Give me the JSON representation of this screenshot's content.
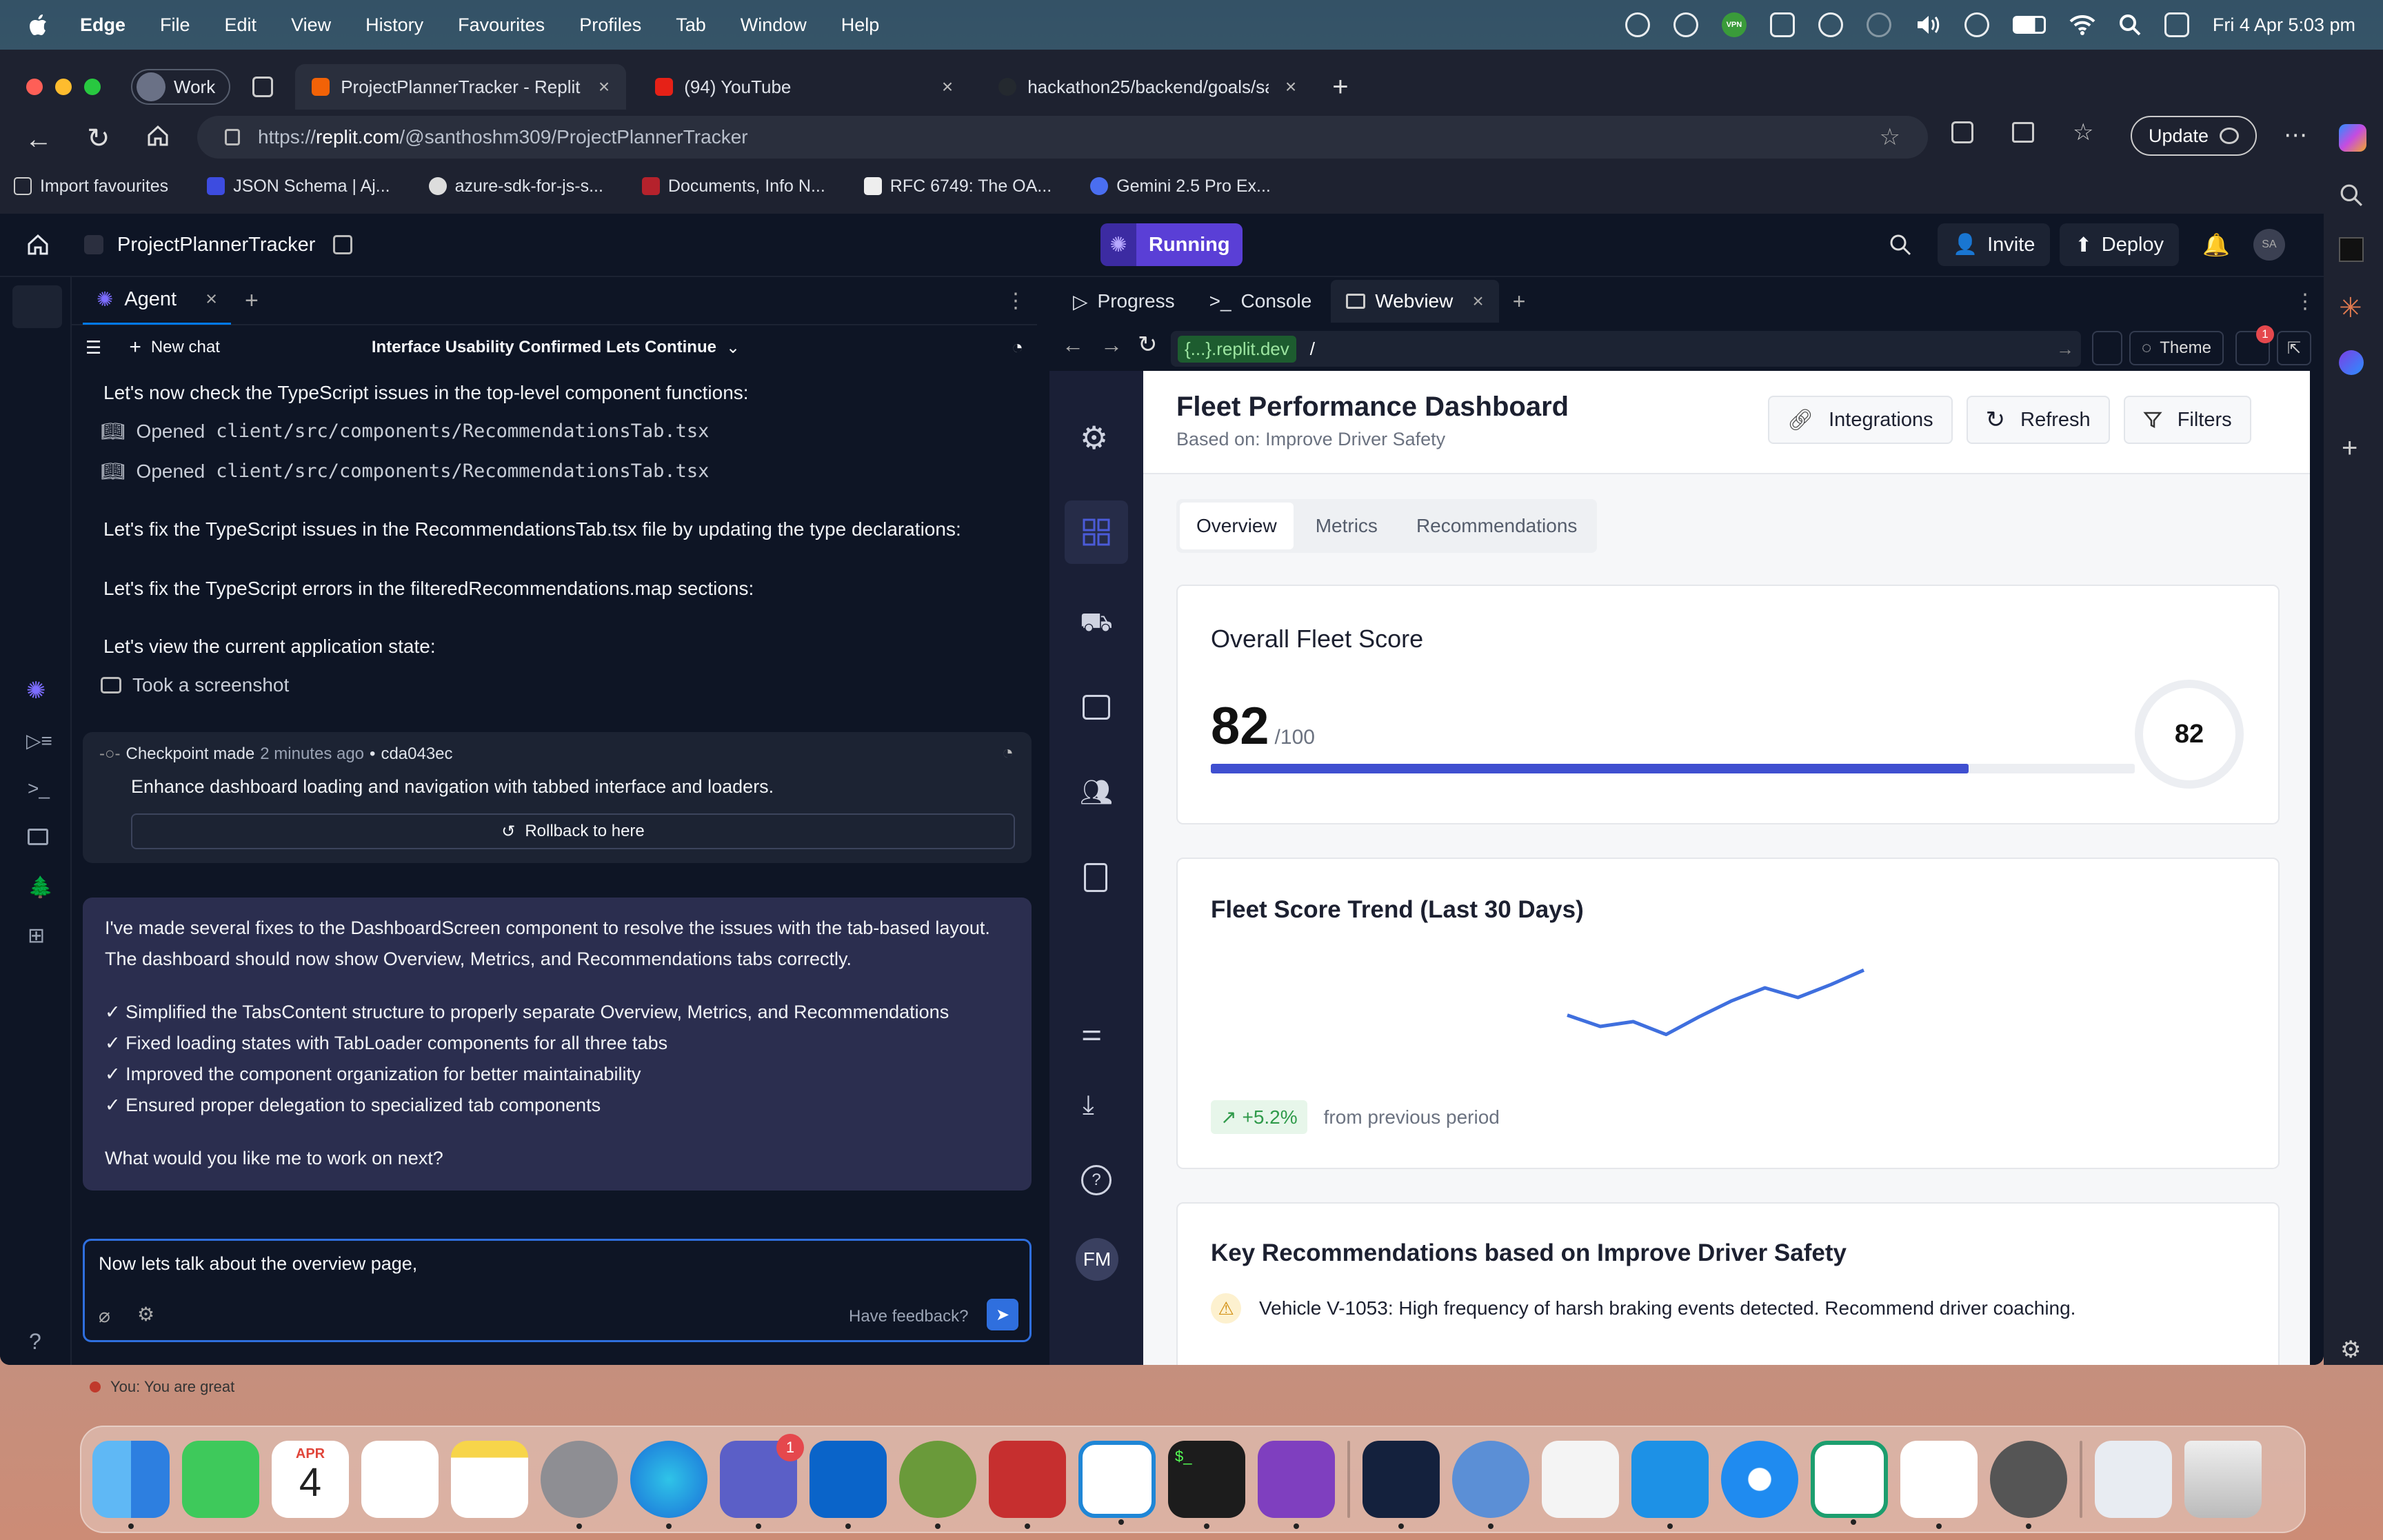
{
  "menubar": {
    "app": "Edge",
    "items": [
      "File",
      "Edit",
      "View",
      "History",
      "Favourites",
      "Profiles",
      "Tab",
      "Window",
      "Help"
    ],
    "clock": "Fri 4 Apr  5:03 pm"
  },
  "browser": {
    "profile": "Work",
    "tabs": [
      {
        "title": "ProjectPlannerTracker - Replit"
      },
      {
        "title": "(94) YouTube"
      },
      {
        "title": "hackathon25/backend/goals/sa"
      }
    ],
    "url_prefix": "https://",
    "url_domain": "replit.com",
    "url_path": "/@santhoshm309/ProjectPlannerTracker",
    "update": "Update",
    "bookmarks": [
      "Import favourites",
      "JSON Schema | Aj...",
      "azure-sdk-for-js-s...",
      "Documents, Info N...",
      "RFC 6749: The OA...",
      "Gemini 2.5 Pro Ex..."
    ]
  },
  "replit": {
    "project": "ProjectPlannerTracker",
    "running": "Running",
    "invite": "Invite",
    "deploy": "Deploy",
    "avatar": "SA",
    "agent": {
      "tab": "Agent",
      "new_chat": "New chat",
      "chat_title": "Interface Usability Confirmed Lets Continue",
      "lines": [
        "Let's now check the TypeScript issues in the top-level component functions:",
        "Let's fix the TypeScript issues in the RecommendationsTab.tsx file by updating the type declarations:",
        "Let's fix the TypeScript errors in the filteredRecommendations.map sections:",
        "Let's view the current application state:"
      ],
      "opened_label": "Opened",
      "opened_file": "client/src/components/RecommendationsTab.tsx",
      "screenshot": "Took a screenshot",
      "checkpoint": {
        "label": "Checkpoint made",
        "time": "2 minutes ago",
        "dot": "•",
        "commit": "cda043ec",
        "desc": "Enhance dashboard loading and navigation with tabbed interface and loaders.",
        "rollback": "Rollback to here"
      },
      "reply": {
        "intro": "I've made several fixes to the DashboardScreen component to resolve the issues with the tab-based layout. The dashboard should now show Overview, Metrics, and Recommendations tabs correctly.",
        "bullets": [
          "✓ Simplified the TabsContent structure to properly separate Overview, Metrics, and Recommendations",
          "✓ Fixed loading states with TabLoader components for all three tabs",
          "✓ Improved the component organization for better maintainability",
          "✓ Ensured proper delegation to specialized tab components"
        ],
        "question": "What would you like me to work on next?"
      },
      "input_value": "Now lets talk about the overview page,",
      "feedback": "Have feedback?"
    },
    "right_tabs": [
      "Progress",
      "Console",
      "Webview"
    ],
    "webview": {
      "domain": "{...}.replit.dev",
      "path": "/",
      "theme": "Theme",
      "badge": "1"
    }
  },
  "dashboard": {
    "title": "Fleet Performance Dashboard",
    "subtitle": "Based on: Improve Driver Safety",
    "buttons": [
      "Integrations",
      "Refresh",
      "Filters"
    ],
    "tabs": [
      "Overview",
      "Metrics",
      "Recommendations"
    ],
    "score_title": "Overall Fleet Score",
    "score": "82",
    "score_max": "/100",
    "score_fraction": 0.82,
    "ring_value": "82",
    "trend_title": "Fleet Score Trend (Last 30 Days)",
    "trend_change": "+5.2%",
    "trend_note": "from previous period",
    "reco_title": "Key Recommendations based on Improve Driver Safety",
    "reco_first": "Vehicle V-1053: High frequency of harsh braking events detected. Recommend driver coaching.",
    "avatar": "FM"
  },
  "chart_data": {
    "type": "line",
    "x": [
      1,
      2,
      3,
      4,
      5,
      6,
      7,
      8,
      9,
      10
    ],
    "values": [
      76.5,
      75.8,
      76.1,
      75.3,
      76.4,
      77.4,
      78.2,
      77.6,
      78.4,
      79.3
    ],
    "title": "Fleet Score Trend (Last 30 Days)",
    "xlabel": "",
    "ylabel": "",
    "ylim": [
      74,
      80
    ],
    "grid": false,
    "color": "#3f6fde"
  },
  "notification": "You: You are great",
  "dock": {
    "calendar_month": "APR",
    "calendar_day": "4",
    "teams_badge": "1"
  },
  "colors": {
    "accent": "#3f4fd0",
    "replit_bg": "#0e1525",
    "running": "#5a3fd6"
  }
}
